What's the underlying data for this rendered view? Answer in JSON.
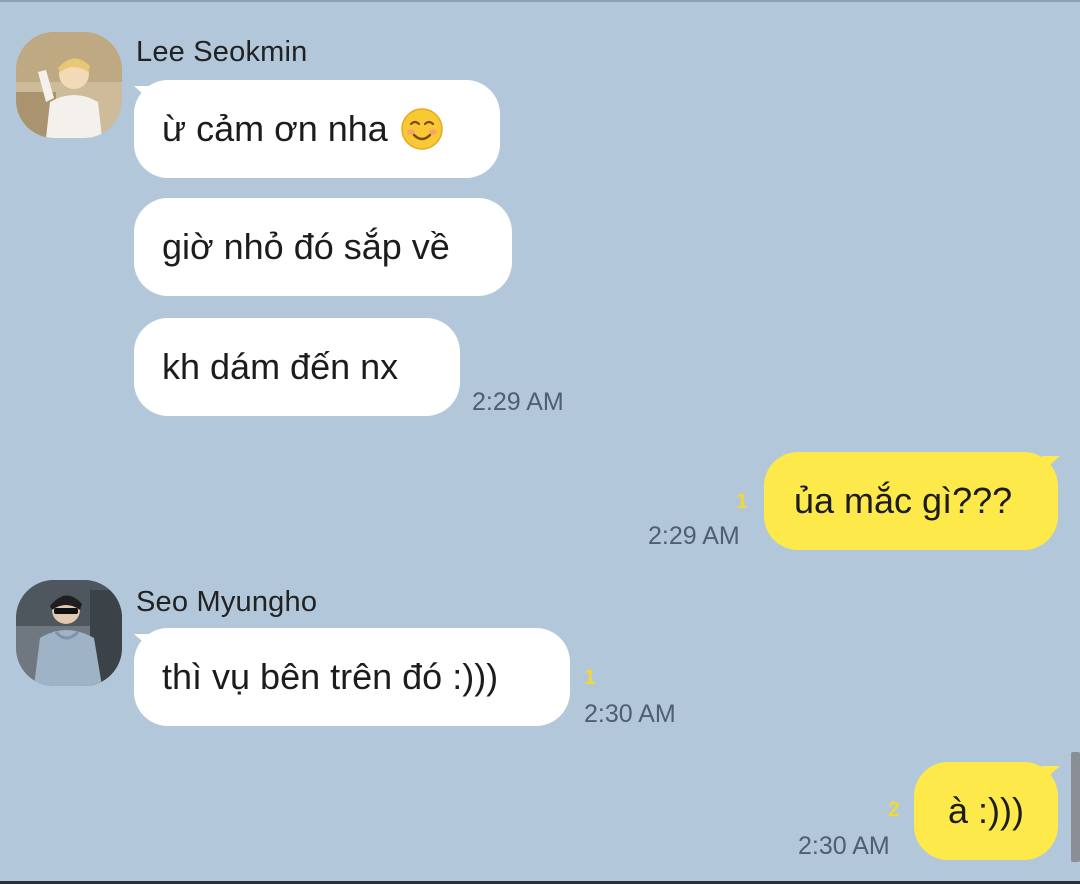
{
  "chat": {
    "messages_group_1": {
      "sender": "Lee Seokmin",
      "avatar_icon": "profile-photo-icon",
      "bubbles": [
        {
          "text": "ừ cảm ơn nha",
          "emoji": "smiling-face-icon"
        },
        {
          "text": "giờ nhỏ đó sắp về"
        },
        {
          "text": "kh dám đến nx"
        }
      ],
      "time": "2:29 AM"
    },
    "my_message_1": {
      "text": "ủa mắc gì???",
      "unread": "1",
      "time": "2:29 AM"
    },
    "messages_group_2": {
      "sender": "Seo Myungho",
      "avatar_icon": "profile-photo-icon",
      "bubbles": [
        {
          "text": "thì vụ bên trên đó :)))"
        }
      ],
      "unread": "1",
      "time": "2:30 AM"
    },
    "my_message_2": {
      "text": "à :)))",
      "unread": "2",
      "time": "2:30 AM"
    }
  },
  "colors": {
    "background": "#b2c7da",
    "incoming_bubble": "#ffffff",
    "outgoing_bubble": "#fee94b",
    "unread_count": "#f0d83a"
  }
}
